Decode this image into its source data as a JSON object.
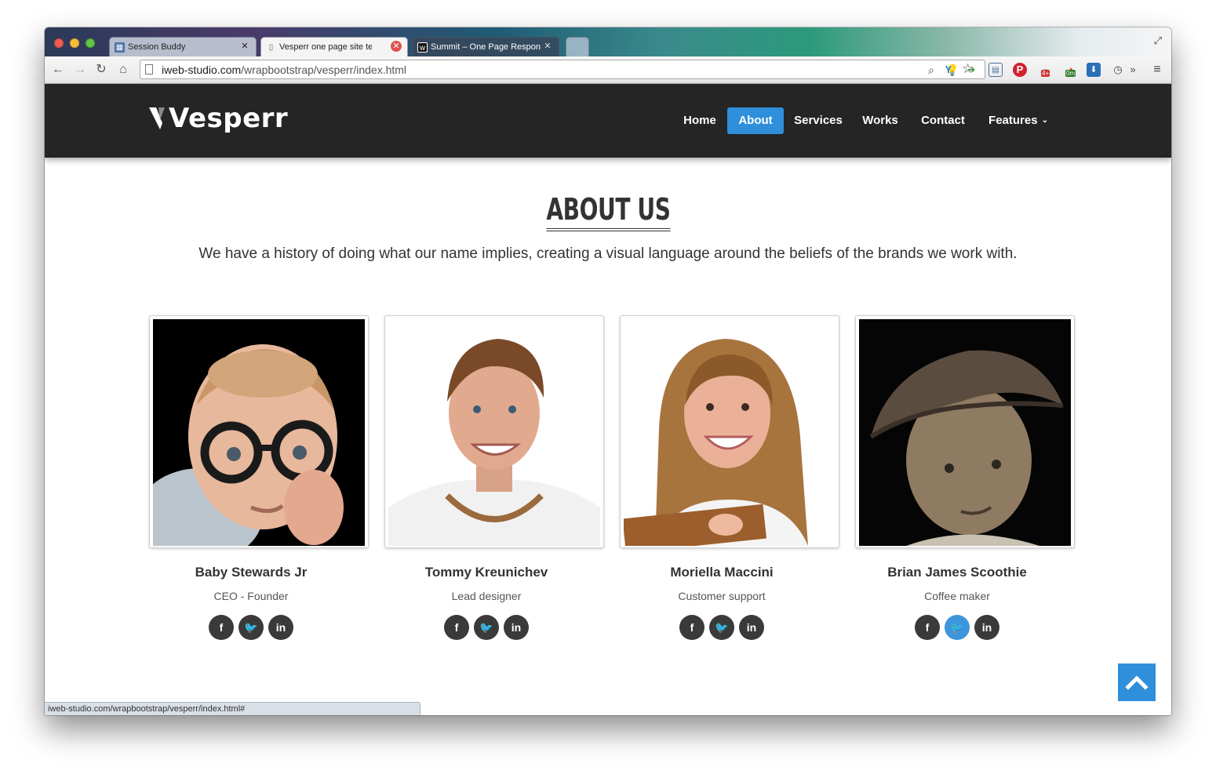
{
  "browser": {
    "tabs": [
      {
        "title": "Session Buddy"
      },
      {
        "title": "Vesperr one page site template"
      },
      {
        "title": "Summit – One Page Responsive"
      }
    ],
    "url_host": "iweb-studio.com",
    "url_path": "/wrapbootstrap/vesperr/index.html",
    "status_url": "iweb-studio.com/wrapbootstrap/vesperr/index.html#",
    "extension_badges": {
      "badge1": "4+",
      "badge2": "0m"
    }
  },
  "site": {
    "logo": "Vesperr",
    "menu": [
      {
        "label": "Home"
      },
      {
        "label": "About"
      },
      {
        "label": "Services"
      },
      {
        "label": "Works"
      },
      {
        "label": "Contact"
      },
      {
        "label": "Features"
      }
    ],
    "accent_color": "#2f8fdb",
    "header_bg": "#252525"
  },
  "about": {
    "title": "ABOUT US",
    "subtitle": "We have a history of doing what our name implies, creating a visual language around the beliefs of the brands we work with.",
    "members": [
      {
        "name": "Baby Stewards Jr",
        "role": "CEO - Founder"
      },
      {
        "name": "Tommy Kreunichev",
        "role": "Lead designer"
      },
      {
        "name": "Moriella Maccini",
        "role": "Customer support"
      },
      {
        "name": "Brian James Scoothie",
        "role": "Coffee maker"
      }
    ],
    "social": {
      "facebook": "f",
      "twitter": "t",
      "linkedin": "in"
    }
  }
}
